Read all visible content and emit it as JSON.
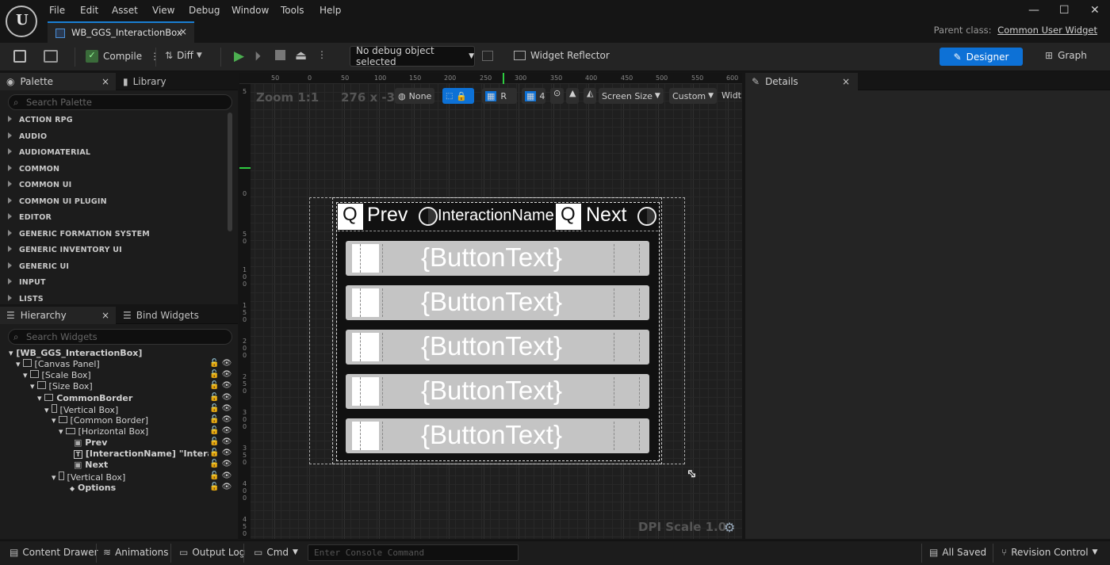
{
  "menu": [
    "File",
    "Edit",
    "Asset",
    "View",
    "Debug",
    "Window",
    "Tools",
    "Help"
  ],
  "tab": {
    "title": "WB_GGS_InteractionBox",
    "close": "×"
  },
  "window": {
    "minimize": "—",
    "maximize": "☐",
    "close": "✕"
  },
  "parent_class": {
    "label": "Parent class:",
    "value": "Common User Widget"
  },
  "toolbar": {
    "compile": "Compile",
    "diff": "Diff",
    "debug_object": "No debug object selected",
    "widget_reflector": "Widget Reflector",
    "designer": "Designer",
    "graph": "Graph"
  },
  "palette": {
    "tab": "Palette",
    "library": "Library",
    "search_placeholder": "Search Palette",
    "categories": [
      "ACTION RPG",
      "AUDIO",
      "AUDIOMATERIAL",
      "COMMON",
      "COMMON UI",
      "COMMON UI PLUGIN",
      "EDITOR",
      "GENERIC FORMATION SYSTEM",
      "GENERIC INVENTORY UI",
      "GENERIC UI",
      "INPUT",
      "LISTS"
    ]
  },
  "hierarchy": {
    "tab": "Hierarchy",
    "bind": "Bind Widgets",
    "search_placeholder": "Search Widgets",
    "items": [
      "[WB_GGS_InteractionBox]",
      "[Canvas Panel]",
      "[Scale Box]",
      "[Size Box]",
      "CommonBorder",
      "[Vertical Box]",
      "[Common Border]",
      "[Horizontal Box]",
      "Prev",
      "[InteractionName] \"Interaction",
      "Next",
      "[Vertical Box]",
      "Options"
    ]
  },
  "viewport": {
    "zoom": "Zoom 1:1",
    "size": "276 x -38",
    "none": "None",
    "r": "R",
    "grid_num": "4",
    "screen_size": "Screen Size",
    "custom": "Custom",
    "width": "Width",
    "dpi": "DPI Scale 1.0",
    "ruler_h": [
      "50",
      "0",
      "50",
      "100",
      "150",
      "200",
      "250",
      "300",
      "350",
      "400",
      "450",
      "500",
      "550",
      "600"
    ],
    "ruler_v": [
      "5",
      "0",
      "1 0 0",
      "5 0",
      "0",
      "5 0",
      "1 0 0",
      "1 5 0",
      "2 0 0",
      "2 5 0",
      "3 0 0",
      "3 5 0",
      "4 0 0",
      "4 5 0",
      "5 0 0"
    ]
  },
  "widget": {
    "key1": "Q",
    "prev": "Prev",
    "interaction_name": "InteractionName",
    "key2": "Q",
    "next": "Next",
    "buttons": [
      "{ButtonText}",
      "{ButtonText}",
      "{ButtonText}",
      "{ButtonText}",
      "{ButtonText}"
    ]
  },
  "details": {
    "tab": "Details"
  },
  "bottom": {
    "content_drawer": "Content Drawer",
    "animations": "Animations",
    "output_log": "Output Log",
    "cmd": "Cmd",
    "console_placeholder": "Enter Console Command",
    "all_saved": "All Saved",
    "revision_control": "Revision Control"
  },
  "colors": {
    "accent": "#0d71d6",
    "panel": "#1c1c1c",
    "play": "#4caf50"
  }
}
